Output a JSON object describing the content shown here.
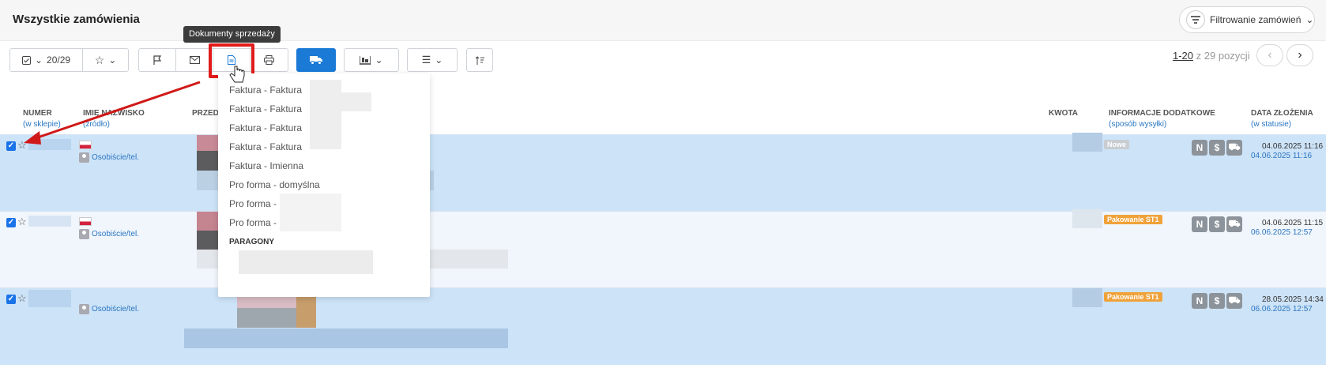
{
  "page": {
    "title": "Wszystkie zamówienia"
  },
  "filter": {
    "label": "Filtrowanie zamówień"
  },
  "toolbar": {
    "selection_count": "20/29",
    "tooltip": "Dokumenty sprzedaży"
  },
  "pagination": {
    "range": "1-20",
    "total_text": "z 29 pozycji"
  },
  "columns": {
    "number": "NUMER",
    "number_sub": "(w sklepie)",
    "name": "IMIĘ NAZWISKO",
    "name_sub": "(źródło)",
    "products": "PRZED",
    "amount": "KWOTA",
    "info": "INFORMACJE DODATKOWE",
    "info_sub": "(sposób wysyłki)",
    "date": "DATA ZŁOŻENIA",
    "date_sub": "(w statusie)"
  },
  "dropdown": {
    "items": [
      "Faktura - Faktura",
      "Faktura - Faktura",
      "Faktura - Faktura",
      "Faktura - Faktura",
      "Faktura - Imienna",
      "Pro forma - domyślna",
      "Pro forma -",
      "Pro forma -"
    ],
    "section_header": "PARAGONY"
  },
  "rows": [
    {
      "source": "Osobiście/tel.",
      "status": "Nowe",
      "status_color": "#c8cdd2",
      "icons": [
        "N",
        "$",
        "truck"
      ],
      "date_created": "04.06.2025 11:16",
      "date_status": "04.06.2025 11:16"
    },
    {
      "source": "Osobiście/tel.",
      "status": "Pakowanie ST1",
      "status_color": "#f0a23a",
      "icons": [
        "N",
        "$",
        "truck"
      ],
      "date_created": "04.06.2025 11:15",
      "date_status": "06.06.2025 12:57"
    },
    {
      "source": "Osobiście/tel.",
      "status": "Pakowanie ST1",
      "status_color": "#f0a23a",
      "icons": [
        "N",
        "$",
        "truck"
      ],
      "date_created": "28.05.2025 14:34",
      "date_status": "06.06.2025 12:57"
    }
  ],
  "colors": {
    "accent": "#1a7ad6",
    "highlight": "#e11b1b",
    "selected_row": "#cde3f7"
  }
}
